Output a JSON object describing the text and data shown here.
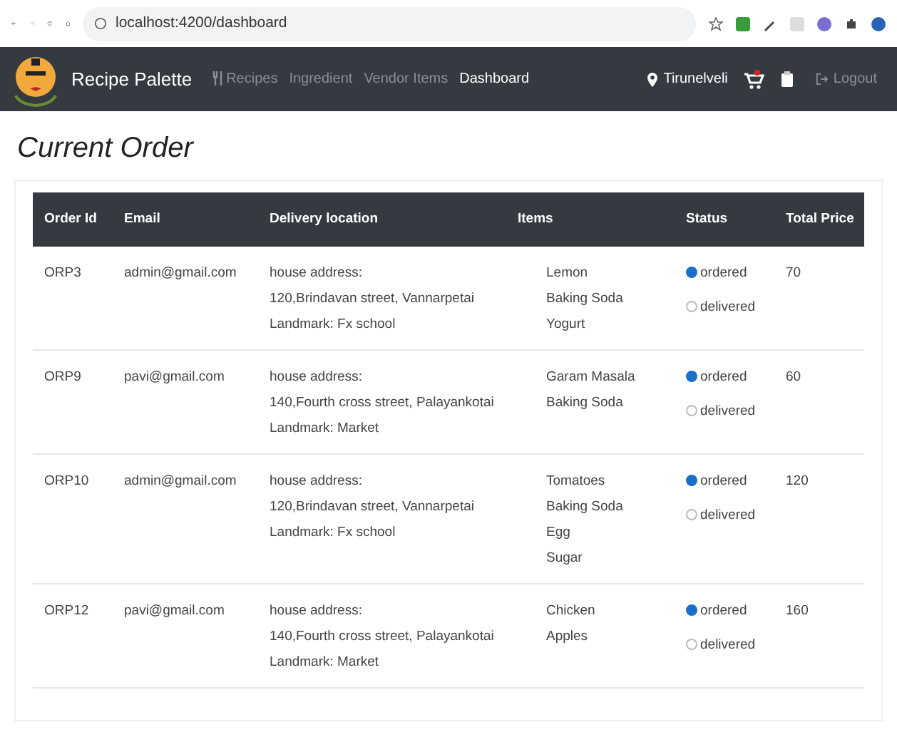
{
  "browser": {
    "url": "localhost:4200/dashboard"
  },
  "navbar": {
    "brand": "Recipe Palette",
    "links": [
      {
        "label": "Recipes",
        "kind": "iconed",
        "selected": false
      },
      {
        "label": "Ingredient",
        "kind": "plain",
        "selected": false
      },
      {
        "label": "Vendor Items",
        "kind": "plain",
        "selected": false
      },
      {
        "label": "Dashboard",
        "kind": "plain",
        "selected": true
      }
    ],
    "location": "Tirunelveli",
    "logout": "Logout"
  },
  "heading": "Current Order",
  "table": {
    "columns": [
      "Order Id",
      "Email",
      "Delivery location",
      "Items",
      "Status",
      "Total Price"
    ],
    "rows": [
      {
        "id": "ORP3",
        "email": "admin@gmail.com",
        "address": [
          "house address:",
          "120,Brindavan street, Vannarpetai",
          "Landmark: Fx school"
        ],
        "items": [
          "Lemon",
          "Baking Soda",
          "Yogurt"
        ],
        "status": [
          {
            "label": "ordered",
            "selected": true
          },
          {
            "label": "delivered",
            "selected": false
          }
        ],
        "price": "70"
      },
      {
        "id": "ORP9",
        "email": "pavi@gmail.com",
        "address": [
          "house address:",
          "140,Fourth cross street, Palayankotai",
          "Landmark: Market"
        ],
        "items": [
          "Garam Masala",
          "Baking Soda"
        ],
        "status": [
          {
            "label": "ordered",
            "selected": true
          },
          {
            "label": "delivered",
            "selected": false
          }
        ],
        "price": "60"
      },
      {
        "id": "ORP10",
        "email": "admin@gmail.com",
        "address": [
          "house address:",
          "120,Brindavan street, Vannarpetai",
          "Landmark: Fx school"
        ],
        "items": [
          "Tomatoes",
          "Baking Soda",
          "Egg",
          "Sugar"
        ],
        "status": [
          {
            "label": "ordered",
            "selected": true
          },
          {
            "label": "delivered",
            "selected": false
          }
        ],
        "price": "120"
      },
      {
        "id": "ORP12",
        "email": "pavi@gmail.com",
        "address": [
          "house address:",
          "140,Fourth cross street, Palayankotai",
          "Landmark: Market"
        ],
        "items": [
          "Chicken",
          "Apples"
        ],
        "status": [
          {
            "label": "ordered",
            "selected": true
          },
          {
            "label": "delivered",
            "selected": false
          }
        ],
        "price": "160"
      }
    ]
  }
}
